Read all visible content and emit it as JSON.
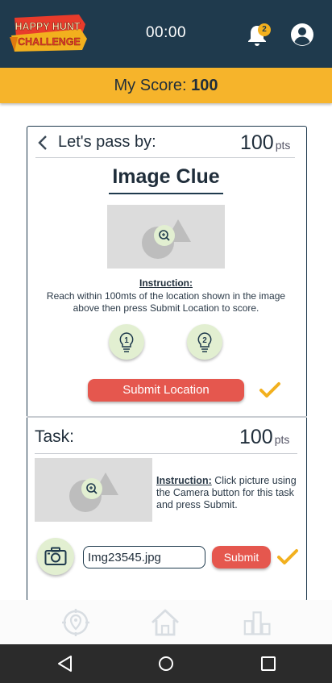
{
  "app": {
    "logo_line1": "HAPPY HUNT",
    "logo_line2": "CHALLENGE",
    "timer": "00:00",
    "notification_count": "2"
  },
  "score": {
    "label": "My Score:",
    "value": "100"
  },
  "clue": {
    "heading": "Let's pass by:",
    "points": "100",
    "points_unit": "pts",
    "title": "Image Clue",
    "instruction_label": "Instruction:",
    "instruction_text": "Reach within 100mts of the location shown in the image above then press Submit Location to score.",
    "hint1": "1",
    "hint2": "2",
    "submit_label": "Submit Location"
  },
  "task": {
    "heading": "Task:",
    "points": "100",
    "points_unit": "pts",
    "instruction_label": "Instruction:",
    "instruction_text": " Click picture using the Camera button for this task and press Submit.",
    "file_value": "Img23545.jpg",
    "submit_label": "Submit"
  },
  "colors": {
    "header_bg": "#1f3a4d",
    "score_bar": "#f6b42b",
    "submit_red": "#e5574e",
    "check_yellow": "#f2b01e",
    "hint_green": "#e2efd1"
  },
  "icons": [
    "bell-icon",
    "user-icon",
    "chevron-left-icon",
    "zoom-icon",
    "bulb-icon",
    "checkmark-icon",
    "camera-icon",
    "crosshair-icon",
    "home-icon",
    "leaderboard-icon",
    "triangle-back-icon",
    "circle-home-icon",
    "square-recent-icon"
  ]
}
